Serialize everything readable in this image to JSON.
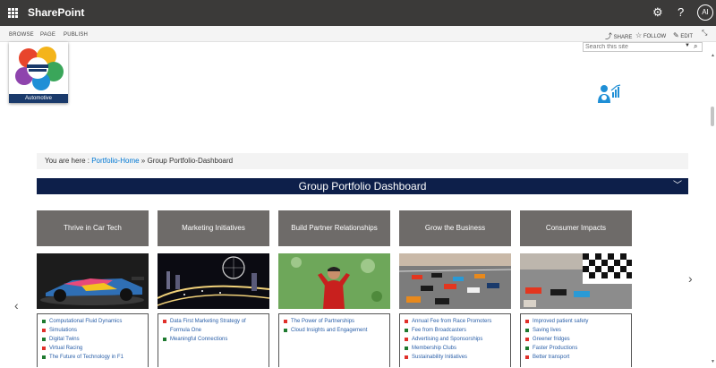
{
  "suitebar": {
    "app_name": "SharePoint",
    "settings_icon": "gear-icon",
    "help_label": "?",
    "avatar_initials": "AI"
  },
  "ribbon": {
    "tabs": [
      "BROWSE",
      "PAGE",
      "PUBLISH"
    ],
    "actions": {
      "share": "SHARE",
      "follow": "FOLLOW",
      "edit": "EDIT"
    }
  },
  "logo": {
    "caption": "Automotive"
  },
  "search": {
    "placeholder": "Search this site"
  },
  "breadcrumb": {
    "prefix": "You are here :",
    "home": "Portfolio-Home",
    "separator": "»",
    "current": "Group Portfolio-Dashboard"
  },
  "dashboard": {
    "title": "Group Portfolio Dashboard"
  },
  "colors": {
    "suitebar": "#3b3a39",
    "dash_bar": "#0d1f4a",
    "tile": "#6e6b69",
    "link": "#2a5fa8",
    "status_green": "#1e7a2f",
    "status_red": "#e0302a"
  },
  "columns": [
    {
      "title": "Thrive in Car Tech",
      "photo": "race-car-photo",
      "items": [
        {
          "label": "Computational Fluid Dynamics",
          "status": "green"
        },
        {
          "label": "Simulations",
          "status": "red"
        },
        {
          "label": "Digital Twins",
          "status": "green"
        },
        {
          "label": "Virtual Racing",
          "status": "red"
        },
        {
          "label": "The Future of Technology in F1",
          "status": "green"
        }
      ]
    },
    {
      "title": "Marketing Initiatives",
      "photo": "night-circuit-photo",
      "items": [
        {
          "label": "Data First Marketing Strategy of Formula One",
          "status": "red"
        },
        {
          "label": "Meaningful Connections",
          "status": "green"
        }
      ]
    },
    {
      "title": "Build Partner Relationships",
      "photo": "driver-celebration-photo",
      "items": [
        {
          "label": "The Power of Partnerships",
          "status": "red"
        },
        {
          "label": "Cloud Insights and Engagement",
          "status": "green"
        }
      ]
    },
    {
      "title": "Grow the Business",
      "photo": "race-start-photo",
      "items": [
        {
          "label": "Annual Fee from Race Promoters",
          "status": "red"
        },
        {
          "label": "Fee from Broadcasters",
          "status": "green"
        },
        {
          "label": "Advertising and Sponsorships",
          "status": "red"
        },
        {
          "label": "Membership Clubs",
          "status": "green"
        },
        {
          "label": "Sustainability Initiatives",
          "status": "red"
        }
      ]
    },
    {
      "title": "Consumer Impacts",
      "photo": "chequered-flag-photo",
      "items": [
        {
          "label": "Improved patient safety",
          "status": "red"
        },
        {
          "label": "Saving lives",
          "status": "green"
        },
        {
          "label": "Greener fridges",
          "status": "red"
        },
        {
          "label": "Faster Productions",
          "status": "green"
        },
        {
          "label": "Better transport",
          "status": "red"
        }
      ]
    }
  ]
}
